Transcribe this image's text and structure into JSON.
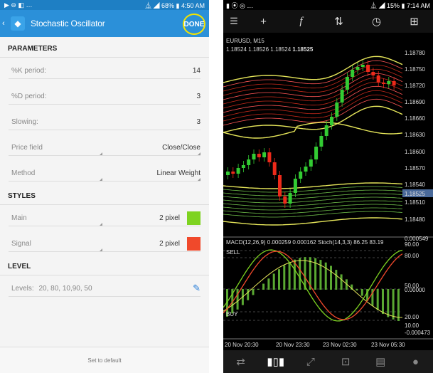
{
  "left_status": {
    "icons": "▶ ⊖ ◧ …",
    "right": "⏅ ◢ 68% ▮ 4:50 AM"
  },
  "header": {
    "back_icon": "back-chevron-icon",
    "title": "Stochastic Oscillator",
    "done_label": "DONE"
  },
  "sections": {
    "parameters": "PARAMETERS",
    "styles": "STYLES",
    "level": "LEVEL"
  },
  "params": [
    {
      "label": "%K period:",
      "value": "14"
    },
    {
      "label": "%D period:",
      "value": "3"
    },
    {
      "label": "Slowing:",
      "value": "3"
    }
  ],
  "selects": [
    {
      "label": "Price field",
      "value": "Close/Close"
    },
    {
      "label": "Method",
      "value": "Linear Weight"
    }
  ],
  "styles": [
    {
      "label": "Main",
      "value": "2 pixel",
      "color": "#7ed321"
    },
    {
      "label": "Signal",
      "value": "2 pixel",
      "color": "#f0492b"
    }
  ],
  "levels": {
    "label": "Levels:",
    "value": "20, 80, 10,90, 50"
  },
  "footer": {
    "set_default": "Set to default"
  },
  "right_status": {
    "left": "▮ ⦿ ◎ …",
    "right": "⏅ ◢ 15% ▮ 7:14 AM"
  },
  "chart": {
    "symbol": "EURUSD, M15",
    "quote_a": "1.18524 1.18526 1.18524 ",
    "quote_b": "1.18525",
    "price_ticks": [
      "1.18780",
      "1.18750",
      "1.18720",
      "1.18690",
      "1.18660",
      "1.18630",
      "1.18600",
      "1.18570",
      "1.18540",
      "1.18525",
      "1.18510",
      "1.18480"
    ],
    "indicator_header": "MACD(12,26,9) 0.000259 0.000162 Stoch(14,3,3) 86.25 83.19",
    "ind_ticks": [
      "0.000549",
      "90.00",
      "80.00",
      "50.00",
      "0.00000",
      "20.00",
      "10.00",
      "-0.000473"
    ],
    "sell_label": "SELL",
    "buy_label": "BUY",
    "time_ticks": [
      "20 Nov 20:30",
      "20 Nov 23:30",
      "23 Nov 02:30",
      "23 Nov 05:30"
    ],
    "colors": {
      "up": "#33cc33",
      "down": "#ee2a1a",
      "band": "#e6e65a",
      "highlight": "#4a6a9a"
    }
  }
}
